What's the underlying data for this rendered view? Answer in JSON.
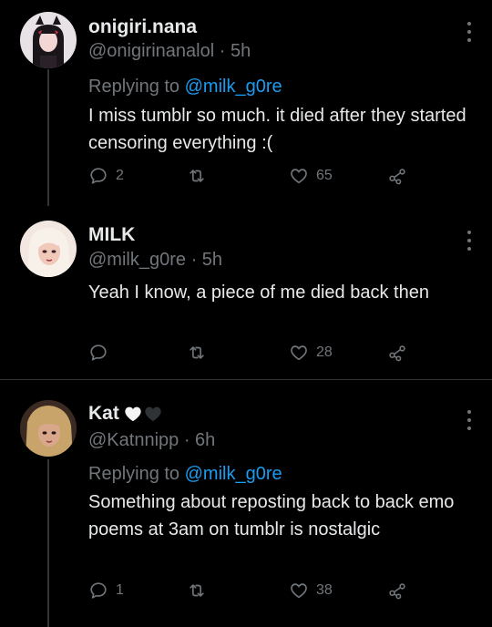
{
  "tweets": [
    {
      "display_name": "onigiri.nana",
      "handle": "@onigirinanalol",
      "time": "5h",
      "replying_prefix": "Replying to",
      "replying_to": "@milk_g0re",
      "text": "I miss tumblr so much. it died after they started censoring everything :(",
      "reply_count": "2",
      "retweet_count": "",
      "like_count": "65"
    },
    {
      "display_name": "MILK",
      "handle": "@milk_g0re",
      "time": "5h",
      "text": "Yeah I know, a piece of me died back then",
      "reply_count": "",
      "retweet_count": "",
      "like_count": "28"
    },
    {
      "display_name": "Kat",
      "handle": "@Katnnipp",
      "time": "6h",
      "replying_prefix": "Replying to",
      "replying_to": "@milk_g0re",
      "text": "Something about reposting back to back emo poems at 3am on tumblr is nostalgic",
      "reply_count": "1",
      "retweet_count": "",
      "like_count": "38"
    }
  ],
  "separator": " · ",
  "colors": {
    "background": "#000000",
    "text": "#e7e9ea",
    "secondary": "#71767b",
    "link": "#1d9bf0"
  },
  "icons": [
    "reply-icon",
    "retweet-icon",
    "like-icon",
    "share-icon",
    "more-icon",
    "white-heart-icon",
    "black-heart-icon"
  ]
}
